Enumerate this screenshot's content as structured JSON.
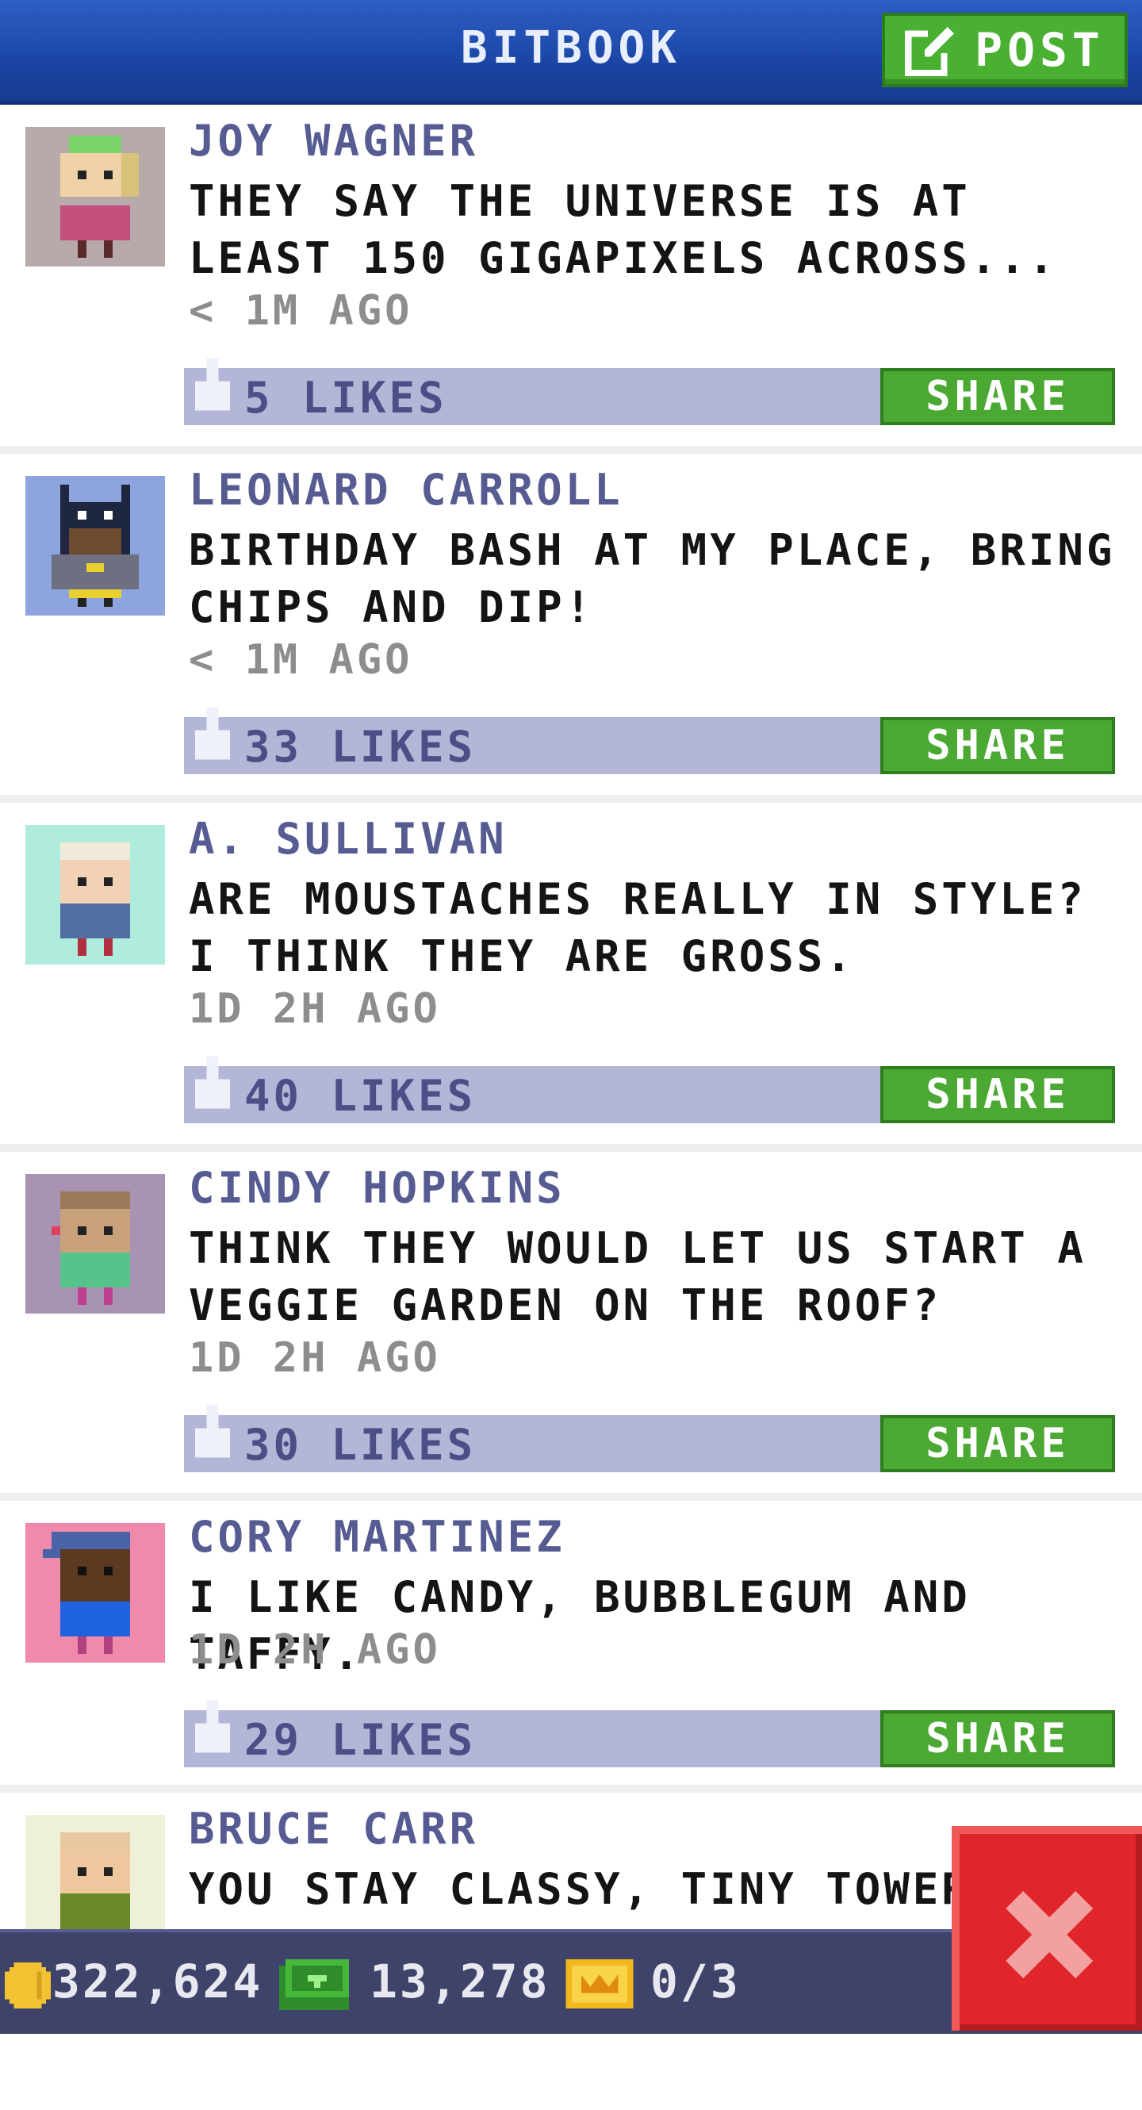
{
  "header": {
    "title": "BITBOOK",
    "post_label": "POST"
  },
  "posts": [
    {
      "name": "JOY WAGNER",
      "message": "THEY SAY THE UNIVERSE IS AT LEAST 150 GIGAPIXELS ACROSS...",
      "time": "< 1M AGO",
      "likes": "5 LIKES",
      "share": "SHARE"
    },
    {
      "name": "LEONARD CARROLL",
      "message": "BIRTHDAY BASH AT MY PLACE, BRING CHIPS AND DIP!",
      "time": "< 1M AGO",
      "likes": "33 LIKES",
      "share": "SHARE"
    },
    {
      "name": "A. SULLIVAN",
      "message": "ARE MOUSTACHES REALLY IN STYLE? I THINK THEY ARE GROSS.",
      "time": "1D 2H AGO",
      "likes": "40 LIKES",
      "share": "SHARE"
    },
    {
      "name": "CINDY HOPKINS",
      "message": "THINK THEY WOULD LET US START A VEGGIE GARDEN ON THE ROOF?",
      "time": "1D 2H AGO",
      "likes": "30 LIKES",
      "share": "SHARE"
    },
    {
      "name": "CORY MARTINEZ",
      "message": "I LIKE CANDY, BUBBLEGUM AND TAFFY.",
      "time": "1D 2H AGO",
      "likes": "29 LIKES",
      "share": "SHARE"
    },
    {
      "name": "BRUCE CARR",
      "message": "YOU STAY CLASSY, TINY TOWER"
    }
  ],
  "footer": {
    "coins": "322,624",
    "bux": "13,278",
    "tickets": "0/3"
  },
  "colors": {
    "header_blue": "#1b46a6",
    "share_green": "#4ba933",
    "like_bar": "#b4b6d8",
    "close_red": "#e0262a"
  },
  "icons": {
    "post": "edit-icon",
    "like": "thumbs-up-icon",
    "coin": "coin-icon",
    "bux": "cash-icon",
    "tickets": "ticket-icon",
    "close": "close-icon"
  }
}
